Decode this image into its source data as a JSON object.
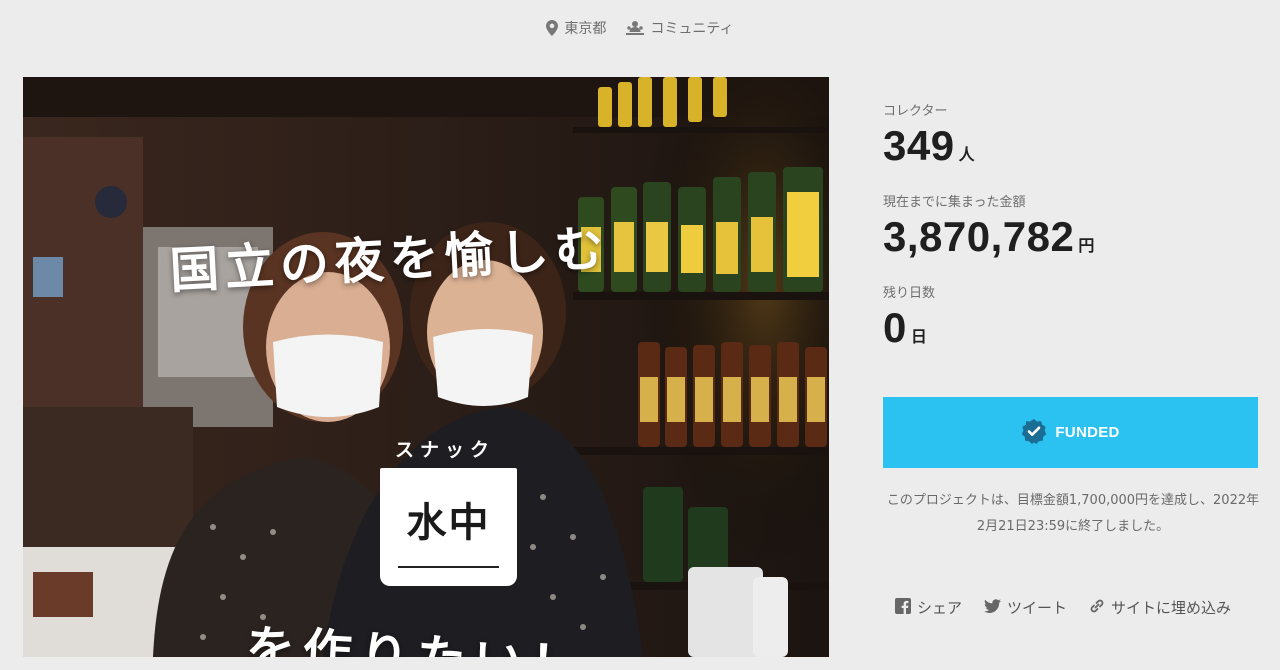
{
  "meta": {
    "location": "東京都",
    "location_icon": "map-pin-icon",
    "category": "コミュニティ",
    "category_icon": "community-icon"
  },
  "hero": {
    "title": "国立の夜を愉しむ",
    "logo_kana": "スナック",
    "logo_text": "水中",
    "subtitle": "を作りたい！"
  },
  "stats": {
    "collectors_label": "コレクター",
    "collectors_value": "349",
    "collectors_unit": "人",
    "amount_label": "現在までに集まった金額",
    "amount_value": "3,870,782",
    "amount_unit": "円",
    "days_label": "残り日数",
    "days_value": "0",
    "days_unit": "日"
  },
  "funded_button": {
    "label": "FUNDED",
    "icon": "verified-badge-icon",
    "color": "#2bc1f0"
  },
  "note": {
    "line1": "このプロジェクトは、目標金額1,700,000円を達成し、2022年",
    "line2": "2月21日23:59に終了しました。"
  },
  "share": {
    "facebook_label": "シェア",
    "twitter_label": "ツイート",
    "embed_label": "サイトに埋め込み"
  }
}
